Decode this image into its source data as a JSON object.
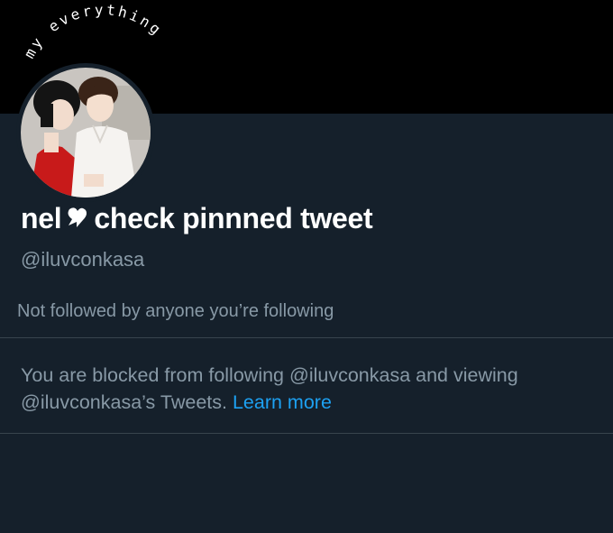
{
  "banner": {
    "caption": "my everything"
  },
  "profile": {
    "display_name_prefix": "nel",
    "display_name_suffix": "check pinnned tweet",
    "handle": "@iluvconkasa",
    "followed_by": "Not followed by anyone you’re following"
  },
  "blocked_notice": {
    "line1": "You are blocked from following @iluvconkasa and viewing",
    "line2": "@iluvconkasa’s Tweets.",
    "link": "Learn more"
  },
  "colors": {
    "background": "#15202b",
    "banner": "#000000",
    "primary_text": "#ffffff",
    "secondary_text": "#8899a6",
    "link": "#1da1f2",
    "divider": "#38444d"
  }
}
